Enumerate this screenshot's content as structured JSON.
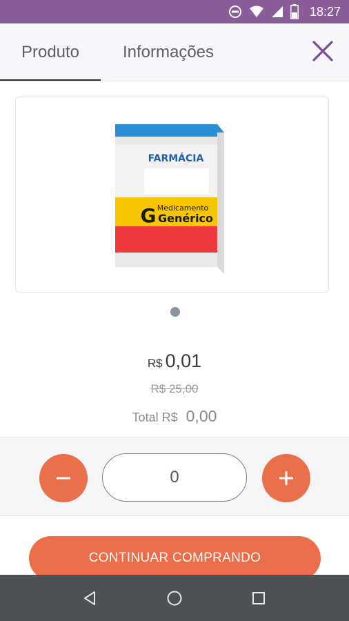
{
  "status_bar": {
    "time": "18:27",
    "icons": [
      "do-not-disturb-icon",
      "wifi-icon",
      "signal-icon",
      "battery-icon"
    ]
  },
  "tabs": [
    {
      "label": "Produto",
      "active": true
    },
    {
      "label": "Informações",
      "active": false
    }
  ],
  "close_icon": "close-icon",
  "product_image": {
    "box_brand": "FARMÁCIA",
    "generic_badge_letter": "G",
    "generic_badge_line1": "Medicamento",
    "generic_badge_line2": "Genérico"
  },
  "carousel": {
    "pages": 1,
    "active": 0
  },
  "price": {
    "currency": "R$",
    "value": "0,01",
    "old_price": "R$ 25,00",
    "total_label": "Total R$",
    "total_value": "0,00"
  },
  "quantity": {
    "value": "0",
    "minus_icon": "minus-icon",
    "plus_icon": "plus-icon"
  },
  "continue_button": {
    "label": "CONTINUAR COMPRANDO"
  },
  "nav_bar": {
    "icons": [
      "back-icon",
      "home-icon",
      "recents-icon"
    ]
  },
  "colors": {
    "status_bar": "#8a5c9a",
    "accent": "#e9704a",
    "close": "#7b4a95",
    "nav_bar": "#4e5254"
  }
}
